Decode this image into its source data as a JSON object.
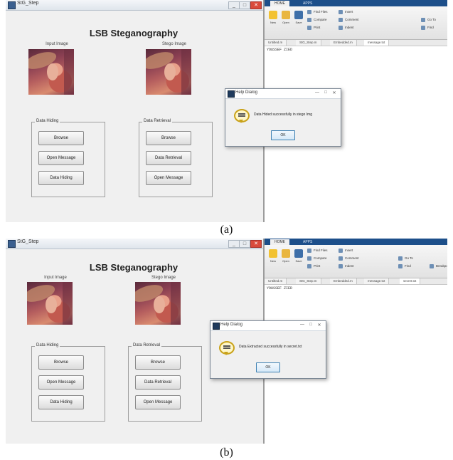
{
  "panels": [
    {
      "caption": "(a)",
      "gui": {
        "window_title": "StG_Step",
        "app_title": "LSB Steganography",
        "cover_label": "Input Image",
        "stego_label": "Stego Image",
        "left_group": {
          "title": "Data Hiding",
          "buttons": [
            "Browse",
            "Open Message",
            "Data Hiding"
          ]
        },
        "right_group": {
          "title": "Data Retrieval",
          "buttons": [
            "Browse",
            "Data Retrieval",
            "Open Message"
          ]
        }
      },
      "matlab": {
        "tabs": [
          "HOME",
          "APPS"
        ],
        "ribbon": {
          "new": "New",
          "open": "Open",
          "save": "Save",
          "find_files": "Find Files",
          "compare": "Compare",
          "print": "Print",
          "insert": "Insert",
          "comment": "Comment",
          "indent": "Indent",
          "go_to": "Go To",
          "find": "Find"
        },
        "file_tabs": [
          "Untitled.m",
          "StG_Step.m",
          "Embedded.m",
          "message.txt"
        ],
        "code_line": "YOUSSEF ZIED"
      },
      "dialog": {
        "title": "Help Dialog",
        "message": "Data Hided successfully in stego Img",
        "ok": "OK",
        "controls": [
          "—",
          "□",
          "✕"
        ]
      }
    },
    {
      "caption": "(b)",
      "gui": {
        "window_title": "StG_Step",
        "app_title": "LSB Steganography",
        "cover_label": "Input Image",
        "stego_label": "Stego Image",
        "left_group": {
          "title": "Data Hiding",
          "buttons": [
            "Browse",
            "Open Message",
            "Data Hiding"
          ]
        },
        "right_group": {
          "title": "Data Retrieval",
          "buttons": [
            "Browse",
            "Data Retrieval",
            "Open Message"
          ]
        }
      },
      "matlab": {
        "tabs": [
          "HOME",
          "APPS"
        ],
        "ribbon": {
          "new": "New",
          "open": "Open",
          "save": "Save",
          "find_files": "Find Files",
          "compare": "Compare",
          "print": "Print",
          "insert": "Insert",
          "comment": "Comment",
          "indent": "Indent",
          "go_to": "Go To",
          "find": "Find",
          "breakpoints": "Breakpoints"
        },
        "file_tabs": [
          "Untitled.m",
          "StG_Step.m",
          "Embedded.m",
          "message.txt",
          "secret.txt"
        ],
        "code_line": "YOUSSEF ZIED"
      },
      "dialog": {
        "title": "Help Dialog",
        "message": "Data Extracted successfully in secret.txt",
        "ok": "OK",
        "controls": [
          "—",
          "□",
          "✕"
        ]
      }
    }
  ]
}
